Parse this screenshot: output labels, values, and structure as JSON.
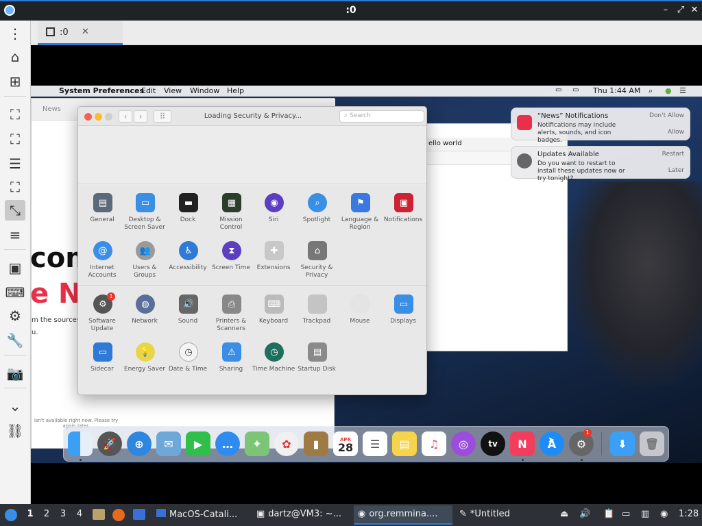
{
  "window": {
    "title": ":0"
  },
  "tabs": [
    {
      "label": ":0"
    }
  ],
  "mac": {
    "menubar": {
      "app": "System Preferences",
      "items": [
        "Edit",
        "View",
        "Window",
        "Help"
      ],
      "clock": "Thu 1:44 AM"
    },
    "news_window": {
      "tab": "News",
      "headline_1": "com",
      "headline_2": "e Ne",
      "line_1": "m the sources",
      "line_2": "u.",
      "unavailable": "isn't available right now. Please try again later."
    },
    "text_window": {
      "content": "ello world"
    },
    "syspref": {
      "title": "Loading Security & Privacy...",
      "search_placeholder": "Search",
      "row1": [
        "General",
        "Desktop & Screen Saver",
        "Dock",
        "Mission Control",
        "Siri",
        "Spotlight",
        "Language & Region",
        "Notifications"
      ],
      "row2": [
        "Internet Accounts",
        "Users & Groups",
        "Accessibility",
        "Screen Time",
        "Extensions",
        "Security & Privacy"
      ],
      "row3": [
        "Software Update",
        "Network",
        "Sound",
        "Printers & Scanners",
        "Keyboard",
        "Trackpad",
        "Mouse",
        "Displays"
      ],
      "row4": [
        "Sidecar",
        "Energy Saver",
        "Date & Time",
        "Sharing",
        "Time Machine",
        "Startup Disk"
      ],
      "software_update_badge": "1"
    },
    "notifications": [
      {
        "title": "“News” Notifications",
        "body": "Notifications may include alerts, sounds, and icon badges.",
        "action_1": "Don't Allow",
        "action_2": "Allow"
      },
      {
        "title": "Updates Available",
        "body": "Do you want to restart to install these updates now or try tonight?",
        "action_1": "Restart",
        "action_2": "Later"
      }
    ],
    "dock": {
      "calendar_month": "APR",
      "calendar_day": "28",
      "tv_label": "tv",
      "prefs_badge": "1"
    }
  },
  "taskbar": {
    "workspaces": [
      "1",
      "2",
      "3",
      "4"
    ],
    "tasks": [
      "MacOS-Catali...",
      "dartz@VM3: ~...",
      "org.remmina....",
      "*Untitled"
    ],
    "clock": "1:28"
  },
  "colors": {
    "accent": "#2f7ad6",
    "news_red": "#e8304a"
  }
}
